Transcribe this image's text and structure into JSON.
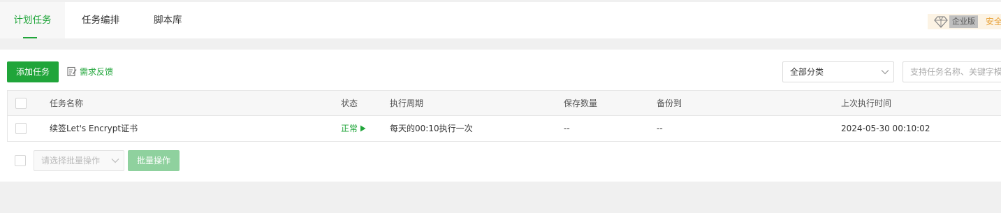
{
  "tabs": [
    {
      "label": "计划任务",
      "active": true
    },
    {
      "label": "任务编排",
      "active": false
    },
    {
      "label": "脚本库",
      "active": false
    }
  ],
  "edition": {
    "label": "企业版",
    "security_text": "安全"
  },
  "toolbar": {
    "add_task_label": "添加任务",
    "feedback_label": "需求反馈",
    "category_select": "全部分类",
    "search_placeholder": "支持任务名称、关键字模糊搜索"
  },
  "table": {
    "headers": {
      "name": "任务名称",
      "status": "状态",
      "cycle": "执行周期",
      "save_count": "保存数量",
      "backup_to": "备份到",
      "last_run": "上次执行时间"
    },
    "rows": [
      {
        "name": "续签Let's Encrypt证书",
        "status": "正常",
        "cycle": "每天的00:10执行一次",
        "save_count": "--",
        "backup_to": "--",
        "last_run": "2024-05-30 00:10:02"
      }
    ]
  },
  "footer": {
    "batch_select_placeholder": "请选择批量操作",
    "batch_button_label": "批量操作"
  },
  "colors": {
    "accent": "#20a53a",
    "accent_disabled": "#8fd19e",
    "warning": "#e8a23a"
  },
  "icons": [
    "diamond-icon",
    "edit-note-icon",
    "chevron-down-icon",
    "play-triangle-icon"
  ]
}
